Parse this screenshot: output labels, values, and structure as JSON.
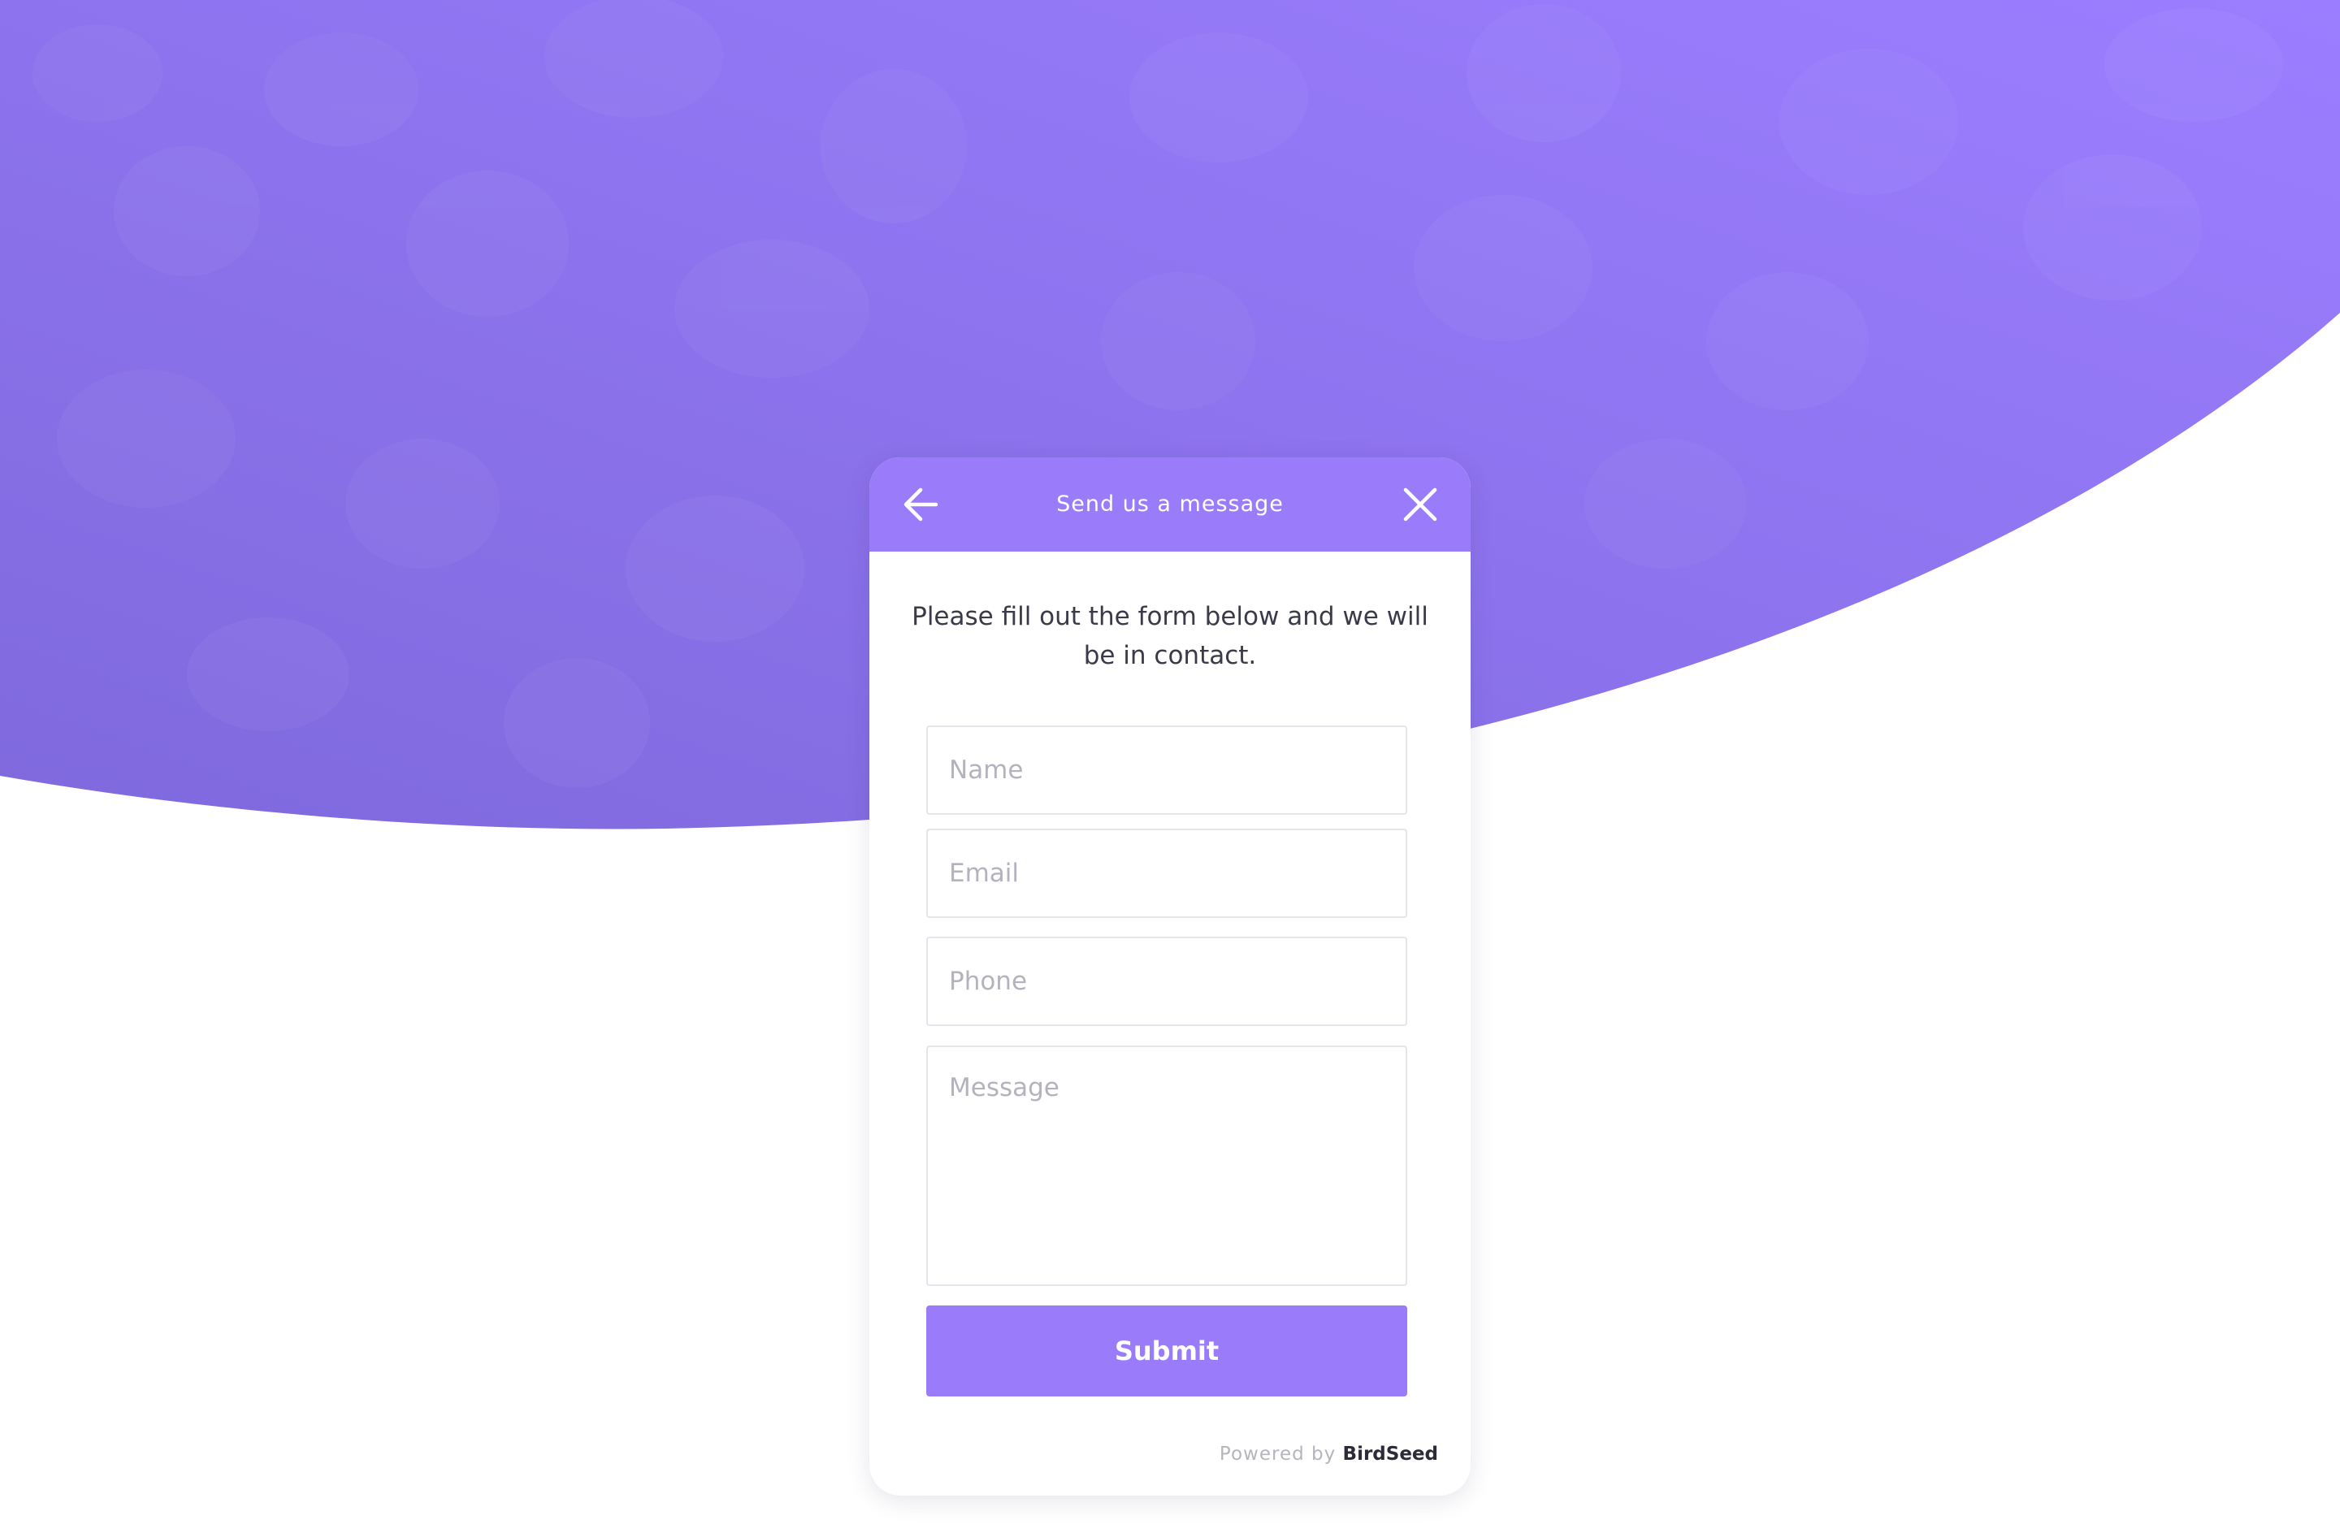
{
  "colors": {
    "accent": "#9a7cfb",
    "background_gradient": [
      "#7f69dd",
      "#9b7eff"
    ],
    "text": "#3a3a48",
    "placeholder": "#b3b3bd"
  },
  "widget": {
    "title": "Send us a message",
    "back_icon": "arrow-left-icon",
    "close_icon": "close-icon",
    "intro": "Please fill out the form below and we will be in contact."
  },
  "form": {
    "name_placeholder": "Name",
    "email_placeholder": "Email",
    "phone_placeholder": "Phone",
    "message_placeholder": "Message",
    "submit_label": "Submit"
  },
  "footer": {
    "powered_by": "Powered by",
    "brand": "BirdSeed"
  }
}
